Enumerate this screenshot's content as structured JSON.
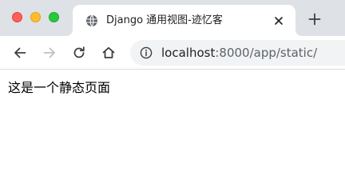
{
  "browser": {
    "tab": {
      "title": "Django 通用视图-迹忆客",
      "favicon_icon": "globe-icon"
    },
    "toolbar": {
      "back_icon": "arrow-left-icon",
      "forward_icon": "arrow-right-icon",
      "reload_icon": "reload-icon",
      "home_icon": "home-icon"
    },
    "address": {
      "info_icon": "info-icon",
      "host": "localhost",
      "rest": ":8000/app/static/"
    }
  },
  "page": {
    "text": "这是一个静态页面"
  },
  "colors": {
    "tabstrip": "#dee1e6",
    "omnibox": "#f1f3f4",
    "close_light": "#ff5f57",
    "minimize_light": "#febc2e",
    "maximize_light": "#28c840"
  }
}
